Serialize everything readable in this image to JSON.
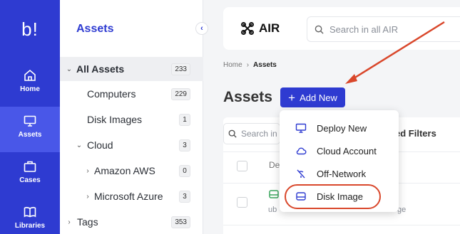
{
  "rail": {
    "logo": "b!",
    "items": [
      {
        "label": "Home",
        "icon": "home-icon"
      },
      {
        "label": "Assets",
        "icon": "monitor-icon"
      },
      {
        "label": "Cases",
        "icon": "briefcase-icon"
      },
      {
        "label": "Libraries",
        "icon": "book-icon"
      }
    ],
    "active": "Assets",
    "color": "#2e3bd1"
  },
  "sidebar": {
    "title": "Assets",
    "tree": [
      {
        "label": "All Assets",
        "count": "233"
      },
      {
        "label": "Computers",
        "count": "229"
      },
      {
        "label": "Disk Images",
        "count": "1"
      },
      {
        "label": "Cloud",
        "count": "3"
      },
      {
        "label": "Amazon AWS",
        "count": "0"
      },
      {
        "label": "Microsoft Azure",
        "count": "3"
      },
      {
        "label": "Tags",
        "count": "353"
      }
    ]
  },
  "topbar": {
    "brand": "AIR",
    "search_placeholder": "Search in all AIR"
  },
  "breadcrumb": {
    "home": "Home",
    "current": "Assets"
  },
  "main": {
    "title": "Assets",
    "add_new_label": "Add New",
    "list_search_placeholder": "Search in",
    "advanced_filters": "ed Filters",
    "col_header": "De",
    "row_sub_a": "ub",
    "row_sub_b": "ge"
  },
  "dropdown": {
    "items": [
      {
        "label": "Deploy New",
        "icon": "monitor-icon"
      },
      {
        "label": "Cloud Account",
        "icon": "cloud-icon"
      },
      {
        "label": "Off-Network",
        "icon": "wifi-off-icon"
      },
      {
        "label": "Disk Image",
        "icon": "disk-icon"
      }
    ],
    "highlighted": "Disk Image",
    "highlight_color": "#d9472b"
  }
}
